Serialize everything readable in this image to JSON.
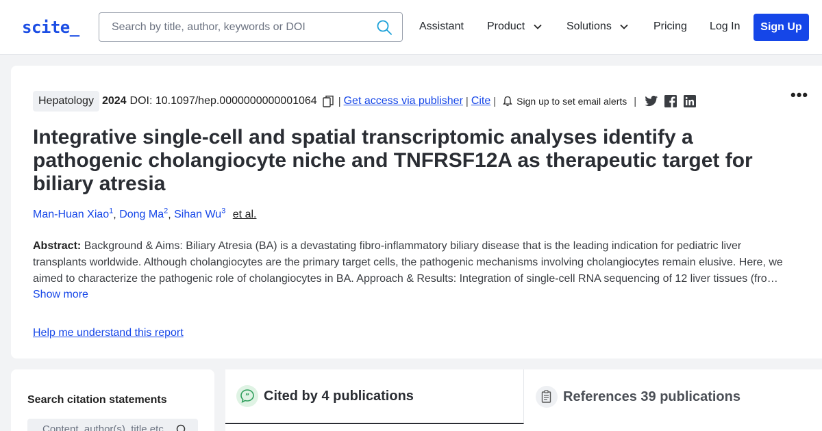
{
  "nav": {
    "logo": "scite_",
    "search_placeholder": "Search by title, author, keywords or DOI",
    "items": [
      "Assistant",
      "Product",
      "Solutions",
      "Pricing",
      "Log In"
    ],
    "signup": "Sign Up",
    "accent": "#1546e8"
  },
  "paper": {
    "journal": "Hepatology",
    "year": "2024",
    "doi": "DOI: 10.1097/hep.0000000000001064",
    "access_link": "Get access via publisher",
    "cite_link": "Cite",
    "alert_text": "Sign up to set email alerts",
    "title": "Integrative single-cell and spatial transcriptomic analyses identify a pathogenic cholangiocyte niche and TNFRSF12A as therapeutic target for biliary atresia",
    "authors": [
      {
        "name": "Man-Huan Xiao",
        "sup": "1"
      },
      {
        "name": "Dong Ma",
        "sup": "2"
      },
      {
        "name": "Sihan Wu",
        "sup": "3"
      }
    ],
    "et_al": "et al.",
    "abstract_label": "Abstract:",
    "abstract_text": "Background & Aims: Biliary Atresia (BA) is a devastating fibro-inflammatory biliary disease that is the leading indication for pediatric liver transplants worldwide. Although cholangiocytes are the primary target cells, the pathogenic mechanisms involving cholangiocytes remain elusive. Here, we aimed to characterize the pathogenic role of cholangiocytes in BA. Approach & Results: Integration of single-cell RNA sequencing of 12 liver tissues (fro…",
    "show_more": "Show more",
    "help_link": "Help me understand this report"
  },
  "citations": {
    "sidebar_title": "Search citation statements",
    "search_placeholder": "Content, author(s), title etc.",
    "tab_cited": "Cited by 4 publications",
    "tab_refs": "References 39 publications"
  }
}
